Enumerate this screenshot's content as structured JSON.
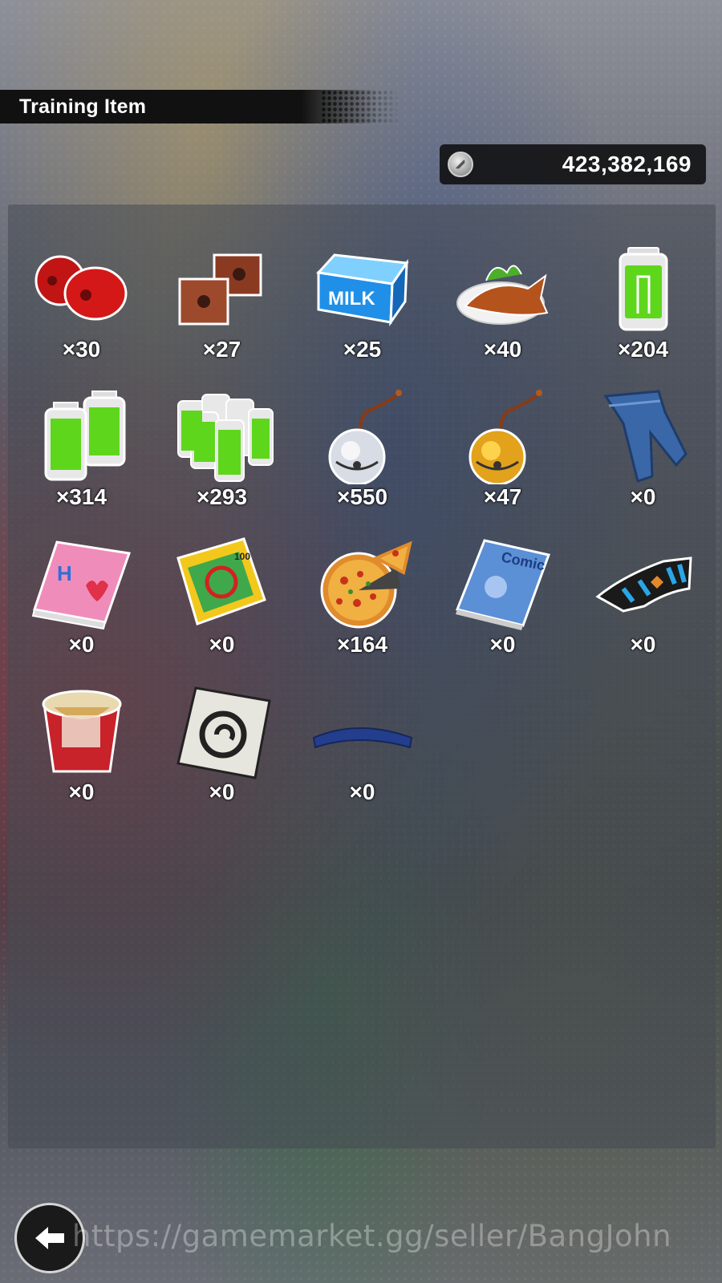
{
  "header": {
    "title": "Training Item"
  },
  "currency": {
    "icon": "coin-icon",
    "value": "423,382,169"
  },
  "items": [
    {
      "icon": "red-weights-icon",
      "count": "×30"
    },
    {
      "icon": "brick-weights-icon",
      "count": "×27"
    },
    {
      "icon": "milk-carton-icon",
      "count": "×25"
    },
    {
      "icon": "grilled-fish-icon",
      "count": "×40"
    },
    {
      "icon": "battery-icon",
      "count": "×204"
    },
    {
      "icon": "double-battery-icon",
      "count": "×314"
    },
    {
      "icon": "battery-pack-icon",
      "count": "×293"
    },
    {
      "icon": "silver-bell-icon",
      "count": "×550"
    },
    {
      "icon": "gold-bell-icon",
      "count": "×47"
    },
    {
      "icon": "jeans-icon",
      "count": "×0"
    },
    {
      "icon": "romance-book-icon",
      "count": "×0"
    },
    {
      "icon": "joke-book-icon",
      "count": "×0"
    },
    {
      "icon": "pizza-icon",
      "count": "×164"
    },
    {
      "icon": "comic-book-icon",
      "count": "×0"
    },
    {
      "icon": "wristband-icon",
      "count": "×0"
    },
    {
      "icon": "cup-noodle-icon",
      "count": "×0"
    },
    {
      "icon": "symbol-card-icon",
      "count": "×0"
    },
    {
      "icon": "headband-icon",
      "count": "×0"
    }
  ],
  "footer": {
    "back_icon": "back-arrow-icon",
    "watermark": "https://gamemarket.gg/seller/BangJohn"
  }
}
